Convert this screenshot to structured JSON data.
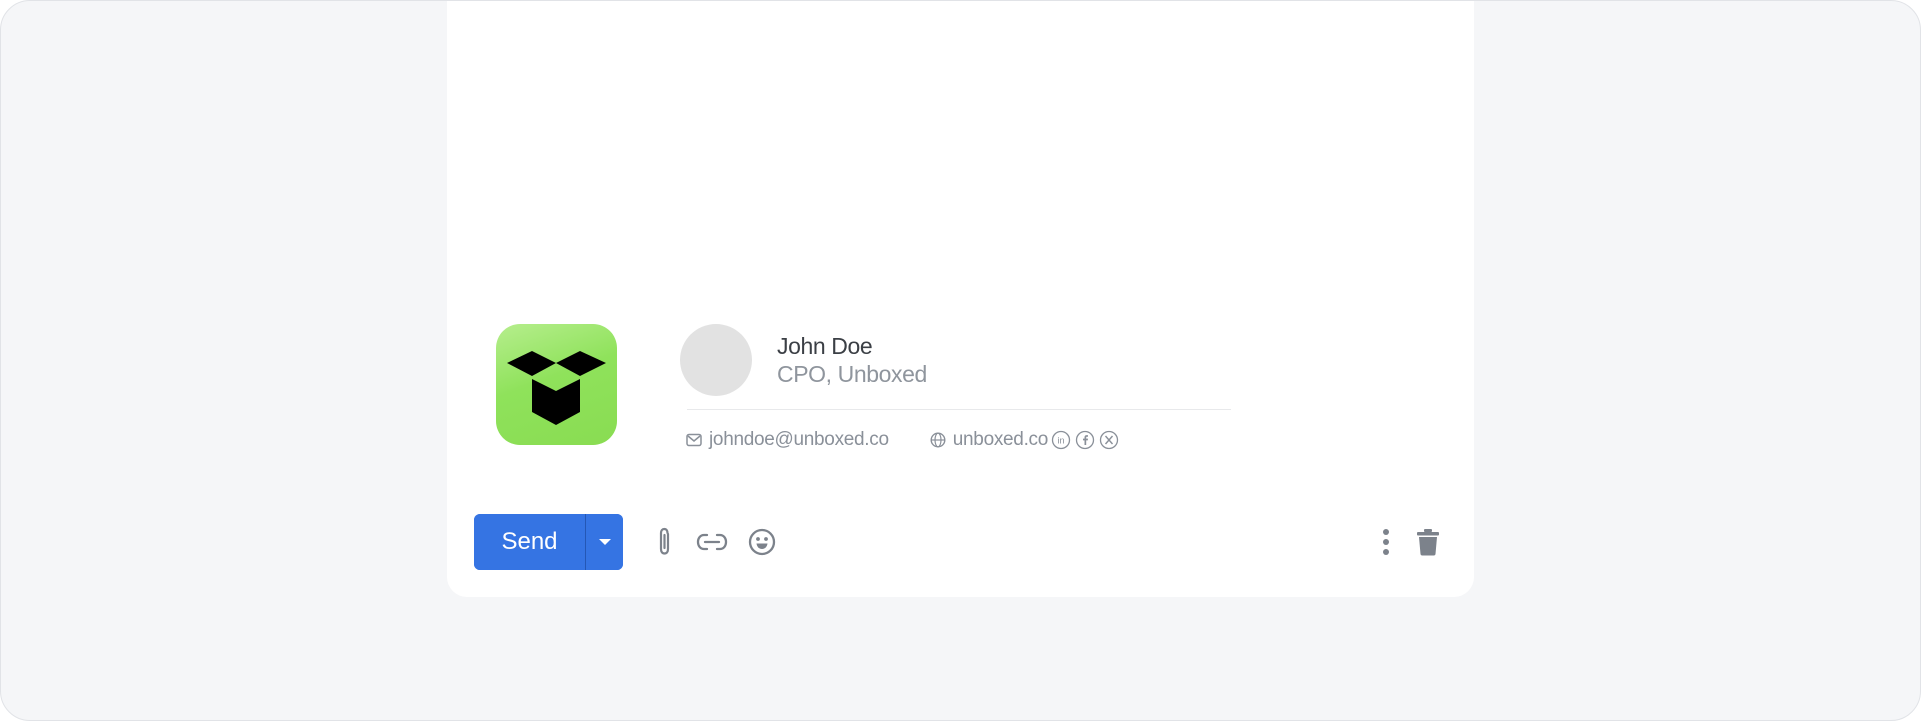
{
  "signature": {
    "logo_icon": "open-box-icon",
    "logo_colors": [
      "#b6ee8d",
      "#89dc52"
    ],
    "name": "John Doe",
    "title": "CPO, Unboxed",
    "email": "johndoe@unboxed.co",
    "website": "unboxed.co",
    "social_icons": [
      "linkedin-icon",
      "facebook-icon",
      "x-icon"
    ]
  },
  "toolbar": {
    "send_label": "Send",
    "send_color": "#3574e3",
    "send_options_icon": "caret-down-icon",
    "tools": [
      "attach-icon",
      "link-icon",
      "emoji-icon"
    ],
    "right_tools": [
      "more-vertical-icon",
      "trash-icon"
    ]
  }
}
